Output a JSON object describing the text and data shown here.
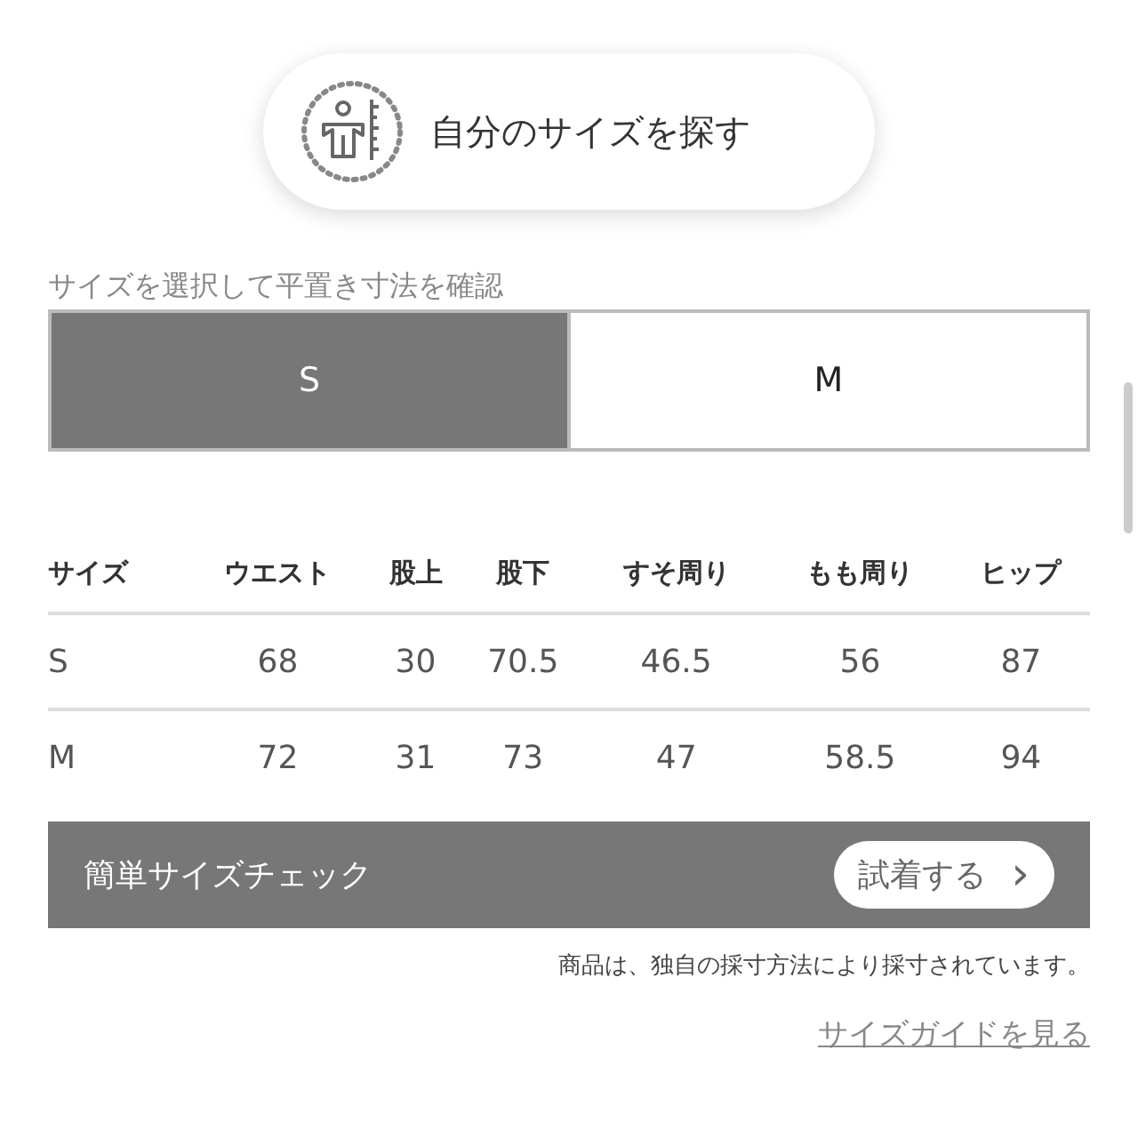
{
  "find_size_button": {
    "label": "自分のサイズを探す"
  },
  "size_select": {
    "label": "サイズを選択して平置き寸法を確認",
    "tabs": [
      {
        "label": "S",
        "selected": true
      },
      {
        "label": "M",
        "selected": false
      }
    ]
  },
  "table": {
    "columns": [
      "サイズ",
      "ウエスト",
      "股上",
      "股下",
      "すそ周り",
      "もも周り",
      "ヒップ"
    ],
    "rows": [
      [
        "S",
        "68",
        "30",
        "70.5",
        "46.5",
        "56",
        "87"
      ],
      [
        "M",
        "72",
        "31",
        "73",
        "47",
        "58.5",
        "94"
      ]
    ]
  },
  "size_check": {
    "title": "簡単サイズチェック",
    "button": "試着する",
    "chevron": "›"
  },
  "note": "商品は、独自の採寸方法により採寸されています。",
  "guide_link": "サイズガイドを見る"
}
